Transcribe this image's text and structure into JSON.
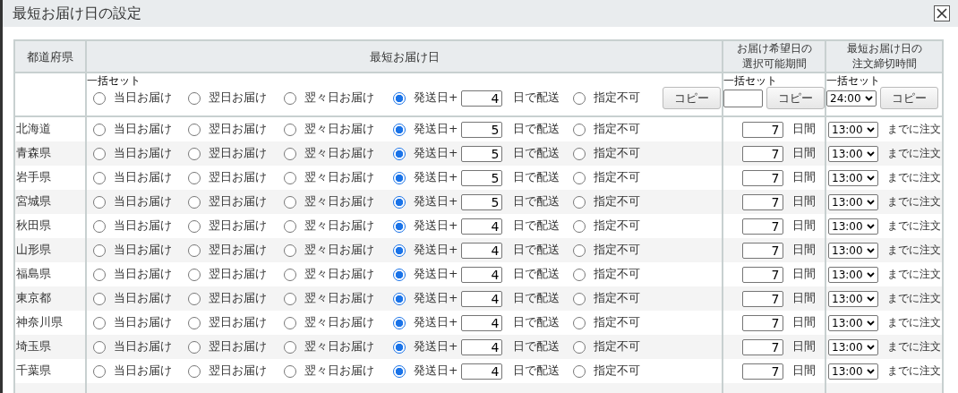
{
  "window": {
    "title": "最短お届け日の設定"
  },
  "columns": [
    "都道府県",
    "最短お届け日",
    "お届け希望日の選択可能期間",
    "最短お届け日の注文締切時間"
  ],
  "bulk_row": {
    "main_label": "一括セット",
    "options": [
      {
        "label": "当日お届け",
        "selected": false
      },
      {
        "label": "翌日お届け",
        "selected": false
      },
      {
        "label": "翌々日お届け",
        "selected": false
      },
      {
        "label": "発送日+",
        "selected": true,
        "days": "4",
        "suffix": "日で配送"
      },
      {
        "label": "指定不可",
        "selected": false
      }
    ],
    "main_button": "コピー",
    "period_label": "一括セット",
    "period_button": "コピー",
    "cutoff_label": "一括セット",
    "cutoff": "24:00",
    "cutoff_button": "コピー"
  },
  "rows": [
    {
      "prefecture": "北海道",
      "options": [
        {
          "label": "当日お届け",
          "selected": false
        },
        {
          "label": "翌日お届け",
          "selected": false
        },
        {
          "label": "翌々日お届け",
          "selected": false
        },
        {
          "label": "発送日+",
          "selected": true,
          "days": "5",
          "suffix": "日で配送"
        },
        {
          "label": "指定不可",
          "selected": false
        }
      ],
      "period": "7",
      "period_unit": "日間",
      "cutoff": "13:00",
      "cutoff_suffix": "までに注文"
    },
    {
      "prefecture": "青森県",
      "options": [
        {
          "label": "当日お届け",
          "selected": false
        },
        {
          "label": "翌日お届け",
          "selected": false
        },
        {
          "label": "翌々日お届け",
          "selected": false
        },
        {
          "label": "発送日+",
          "selected": true,
          "days": "5",
          "suffix": "日で配送"
        },
        {
          "label": "指定不可",
          "selected": false
        }
      ],
      "period": "7",
      "period_unit": "日間",
      "cutoff": "13:00",
      "cutoff_suffix": "までに注文"
    },
    {
      "prefecture": "岩手県",
      "options": [
        {
          "label": "当日お届け",
          "selected": false
        },
        {
          "label": "翌日お届け",
          "selected": false
        },
        {
          "label": "翌々日お届け",
          "selected": false
        },
        {
          "label": "発送日+",
          "selected": true,
          "days": "5",
          "suffix": "日で配送"
        },
        {
          "label": "指定不可",
          "selected": false
        }
      ],
      "period": "7",
      "period_unit": "日間",
      "cutoff": "13:00",
      "cutoff_suffix": "までに注文"
    },
    {
      "prefecture": "宮城県",
      "options": [
        {
          "label": "当日お届け",
          "selected": false
        },
        {
          "label": "翌日お届け",
          "selected": false
        },
        {
          "label": "翌々日お届け",
          "selected": false
        },
        {
          "label": "発送日+",
          "selected": true,
          "days": "5",
          "suffix": "日で配送"
        },
        {
          "label": "指定不可",
          "selected": false
        }
      ],
      "period": "7",
      "period_unit": "日間",
      "cutoff": "13:00",
      "cutoff_suffix": "までに注文"
    },
    {
      "prefecture": "秋田県",
      "options": [
        {
          "label": "当日お届け",
          "selected": false
        },
        {
          "label": "翌日お届け",
          "selected": false
        },
        {
          "label": "翌々日お届け",
          "selected": false
        },
        {
          "label": "発送日+",
          "selected": true,
          "days": "4",
          "suffix": "日で配送"
        },
        {
          "label": "指定不可",
          "selected": false
        }
      ],
      "period": "7",
      "period_unit": "日間",
      "cutoff": "13:00",
      "cutoff_suffix": "までに注文"
    },
    {
      "prefecture": "山形県",
      "options": [
        {
          "label": "当日お届け",
          "selected": false
        },
        {
          "label": "翌日お届け",
          "selected": false
        },
        {
          "label": "翌々日お届け",
          "selected": false
        },
        {
          "label": "発送日+",
          "selected": true,
          "days": "4",
          "suffix": "日で配送"
        },
        {
          "label": "指定不可",
          "selected": false
        }
      ],
      "period": "7",
      "period_unit": "日間",
      "cutoff": "13:00",
      "cutoff_suffix": "までに注文"
    },
    {
      "prefecture": "福島県",
      "options": [
        {
          "label": "当日お届け",
          "selected": false
        },
        {
          "label": "翌日お届け",
          "selected": false
        },
        {
          "label": "翌々日お届け",
          "selected": false
        },
        {
          "label": "発送日+",
          "selected": true,
          "days": "4",
          "suffix": "日で配送"
        },
        {
          "label": "指定不可",
          "selected": false
        }
      ],
      "period": "7",
      "period_unit": "日間",
      "cutoff": "13:00",
      "cutoff_suffix": "までに注文"
    },
    {
      "prefecture": "東京都",
      "options": [
        {
          "label": "当日お届け",
          "selected": false
        },
        {
          "label": "翌日お届け",
          "selected": false
        },
        {
          "label": "翌々日お届け",
          "selected": false
        },
        {
          "label": "発送日+",
          "selected": true,
          "days": "4",
          "suffix": "日で配送"
        },
        {
          "label": "指定不可",
          "selected": false
        }
      ],
      "period": "7",
      "period_unit": "日間",
      "cutoff": "13:00",
      "cutoff_suffix": "までに注文"
    },
    {
      "prefecture": "神奈川県",
      "options": [
        {
          "label": "当日お届け",
          "selected": false
        },
        {
          "label": "翌日お届け",
          "selected": false
        },
        {
          "label": "翌々日お届け",
          "selected": false
        },
        {
          "label": "発送日+",
          "selected": true,
          "days": "4",
          "suffix": "日で配送"
        },
        {
          "label": "指定不可",
          "selected": false
        }
      ],
      "period": "7",
      "period_unit": "日間",
      "cutoff": "13:00",
      "cutoff_suffix": "までに注文"
    },
    {
      "prefecture": "埼玉県",
      "options": [
        {
          "label": "当日お届け",
          "selected": false
        },
        {
          "label": "翌日お届け",
          "selected": false
        },
        {
          "label": "翌々日お届け",
          "selected": false
        },
        {
          "label": "発送日+",
          "selected": true,
          "days": "4",
          "suffix": "日で配送"
        },
        {
          "label": "指定不可",
          "selected": false
        }
      ],
      "period": "7",
      "period_unit": "日間",
      "cutoff": "13:00",
      "cutoff_suffix": "までに注文"
    },
    {
      "prefecture": "千葉県",
      "options": [
        {
          "label": "当日お届け",
          "selected": false
        },
        {
          "label": "翌日お届け",
          "selected": false
        },
        {
          "label": "翌々日お届け",
          "selected": false
        },
        {
          "label": "発送日+",
          "selected": true,
          "days": "4",
          "suffix": "日で配送"
        },
        {
          "label": "指定不可",
          "selected": false
        }
      ],
      "period": "7",
      "period_unit": "日間",
      "cutoff": "13:00",
      "cutoff_suffix": "までに注文"
    }
  ]
}
